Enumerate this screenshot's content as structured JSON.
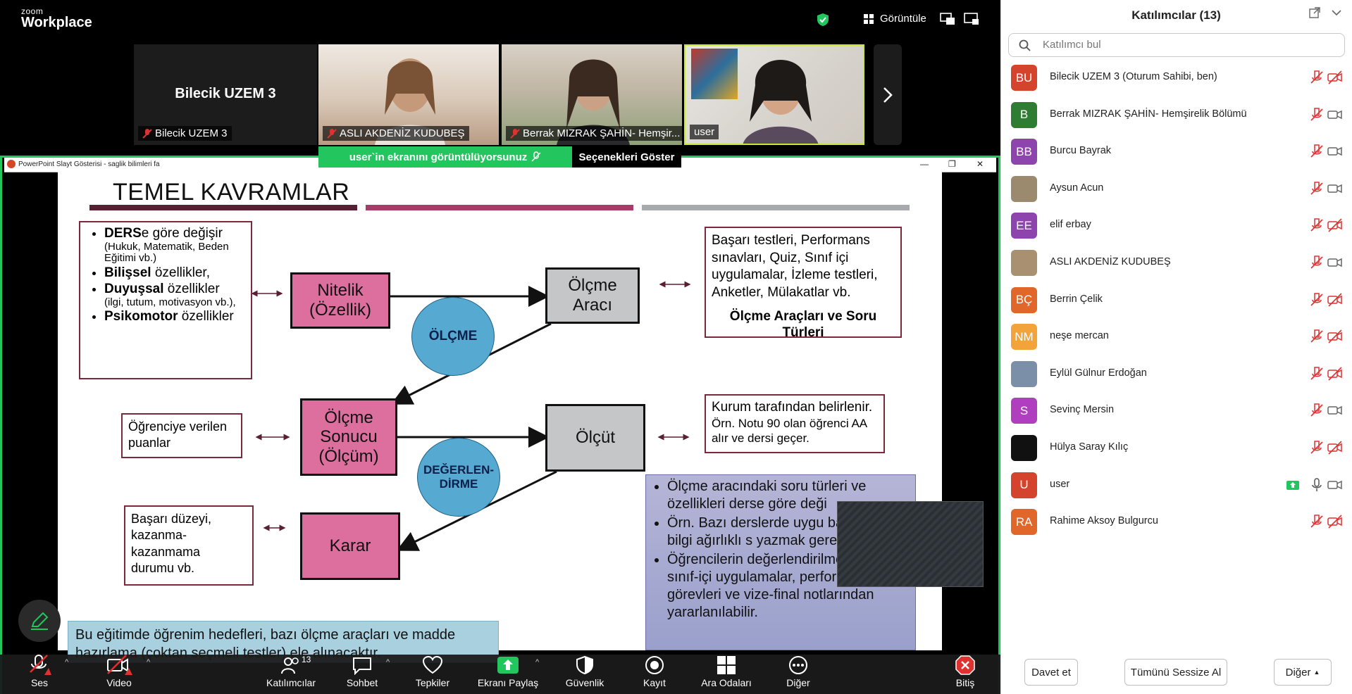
{
  "app": {
    "brand_small": "zoom",
    "brand_big": "Workplace",
    "view_label": "Görüntüle",
    "accent": "#22c55e"
  },
  "videos": [
    {
      "name": "Bilecik UZEM 3",
      "title": "Bilecik UZEM 3",
      "muted": true
    },
    {
      "name": "ASLI AKDENİZ KUDUBEŞ",
      "muted": true
    },
    {
      "name": "Berrak MIZRAK ŞAHİN- Hemşir...",
      "muted": true
    },
    {
      "name": "user",
      "muted": false
    }
  ],
  "share": {
    "banner": "user`in ekranını görüntülüyorsunuz",
    "options_label": "Seçenekleri Göster",
    "ppt_title": "PowerPoint Slayt Gösterisi  -  saglik bilimleri fa"
  },
  "slide": {
    "title": "TEMEL KAVRAMLAR",
    "left_box": {
      "items": [
        {
          "bold": "DERS",
          "rest": "e göre değişir",
          "small": "(Hukuk, Matematik, Beden Eğitimi vb.)"
        },
        {
          "bold": "Bilişsel",
          "rest": " özellikler,",
          "small": ""
        },
        {
          "bold": "Duyuşsal",
          "rest": " özellikler",
          "small": "(ilgi, tutum, motivasyon vb.),"
        },
        {
          "bold": "Psikomotor",
          "rest": " özellikler",
          "small": ""
        }
      ]
    },
    "nitelik": "Nitelik (Özellik)",
    "olcme_araci": "Ölçme Aracı",
    "olcme_circle": "ÖLÇME",
    "right_top": {
      "text": "Başarı testleri, Performans sınavları, Quiz, Sınıf içi uygulamalar, İzleme testleri, Anketler, Mülakatlar vb.",
      "bold": "Ölçme Araçları ve Soru Türleri"
    },
    "ogrenci_puan": "Öğrenciye verilen puanlar",
    "olcme_sonucu": "Ölçme Sonucu (Ölçüm)",
    "olcut": "Ölçüt",
    "degerlendirme_circle": "DEĞERLEN-DİRME",
    "kurum": {
      "line1": "Kurum tarafından belirlenir.",
      "line2": "Örn. Notu 90 olan öğrenci AA alır ve dersi geçer."
    },
    "basari": "Başarı düzeyi, kazanma-kazanmama durumu vb.",
    "karar": "Karar",
    "blue_box": [
      "Ölçme aracındaki soru türleri ve özellikleri derse göre deği",
      "Örn. Bazı derslerde uygu bazılarında bilgi ağırlıklı s yazmak gerekebilir.",
      "Öğrencilerin değerlendirilmesinde sınıf-içi uygulamalar, performans görevleri ve vize-final notlarından yararlanılabilir."
    ],
    "bottom_note": "Bu eğitimde öğrenim hedefleri, bazı ölçme araçları ve madde hazırlama (çoktan seçmeli testler) ele alınacaktır."
  },
  "toolbar": {
    "audio": "Ses",
    "video": "Video",
    "participants": "Katılımcılar",
    "participants_count": "13",
    "chat": "Sohbet",
    "reactions": "Tepkiler",
    "share": "Ekranı Paylaş",
    "security": "Güvenlik",
    "record": "Kayıt",
    "breakout": "Ara Odaları",
    "more": "Diğer",
    "end": "Bitiş"
  },
  "panel": {
    "title": "Katılımcılar (13)",
    "search_placeholder": "Katılımcı bul",
    "invite": "Davet et",
    "mute_all": "Tümünü Sessize Al",
    "more": "Diğer"
  },
  "participants": [
    {
      "initials": "BU",
      "color": "#d4442c",
      "name": "Bilecik UZEM 3 (Oturum Sahibi, ben)",
      "mic": "muted",
      "cam": "off"
    },
    {
      "initials": "B",
      "color": "#2e7d32",
      "name": "Berrak MIZRAK ŞAHİN- Hemşirelik Bölümü",
      "mic": "muted",
      "cam": "on"
    },
    {
      "initials": "BB",
      "color": "#8e44ad",
      "name": "Burcu Bayrak",
      "mic": "muted",
      "cam": "on"
    },
    {
      "initials": "",
      "color": "#9c8a6e",
      "name": "Aysun Acun",
      "mic": "muted",
      "cam": "on"
    },
    {
      "initials": "EE",
      "color": "#8e44ad",
      "name": "elif erbay",
      "mic": "muted",
      "cam": "off"
    },
    {
      "initials": "",
      "color": "#a89070",
      "name": "ASLI AKDENİZ KUDUBEŞ",
      "mic": "muted",
      "cam": "on"
    },
    {
      "initials": "BÇ",
      "color": "#e0662a",
      "name": "Berrin Çelik",
      "mic": "muted",
      "cam": "off"
    },
    {
      "initials": "NM",
      "color": "#f2a33a",
      "name": "neşe mercan",
      "mic": "muted",
      "cam": "off"
    },
    {
      "initials": "",
      "color": "#7b8fa8",
      "name": "Eylül Gülnur Erdoğan",
      "mic": "muted",
      "cam": "off"
    },
    {
      "initials": "S",
      "color": "#b03fc0",
      "name": "Sevinç Mersin",
      "mic": "muted",
      "cam": "on"
    },
    {
      "initials": "",
      "color": "#111111",
      "name": "Hülya Saray Kılıç",
      "mic": "muted",
      "cam": "off"
    },
    {
      "initials": "U",
      "color": "#d4442c",
      "name": "user",
      "mic": "on",
      "cam": "on"
    },
    {
      "initials": "RA",
      "color": "#e0662a",
      "name": "Rahime Aksoy Bulgurcu",
      "mic": "muted",
      "cam": "off"
    }
  ]
}
